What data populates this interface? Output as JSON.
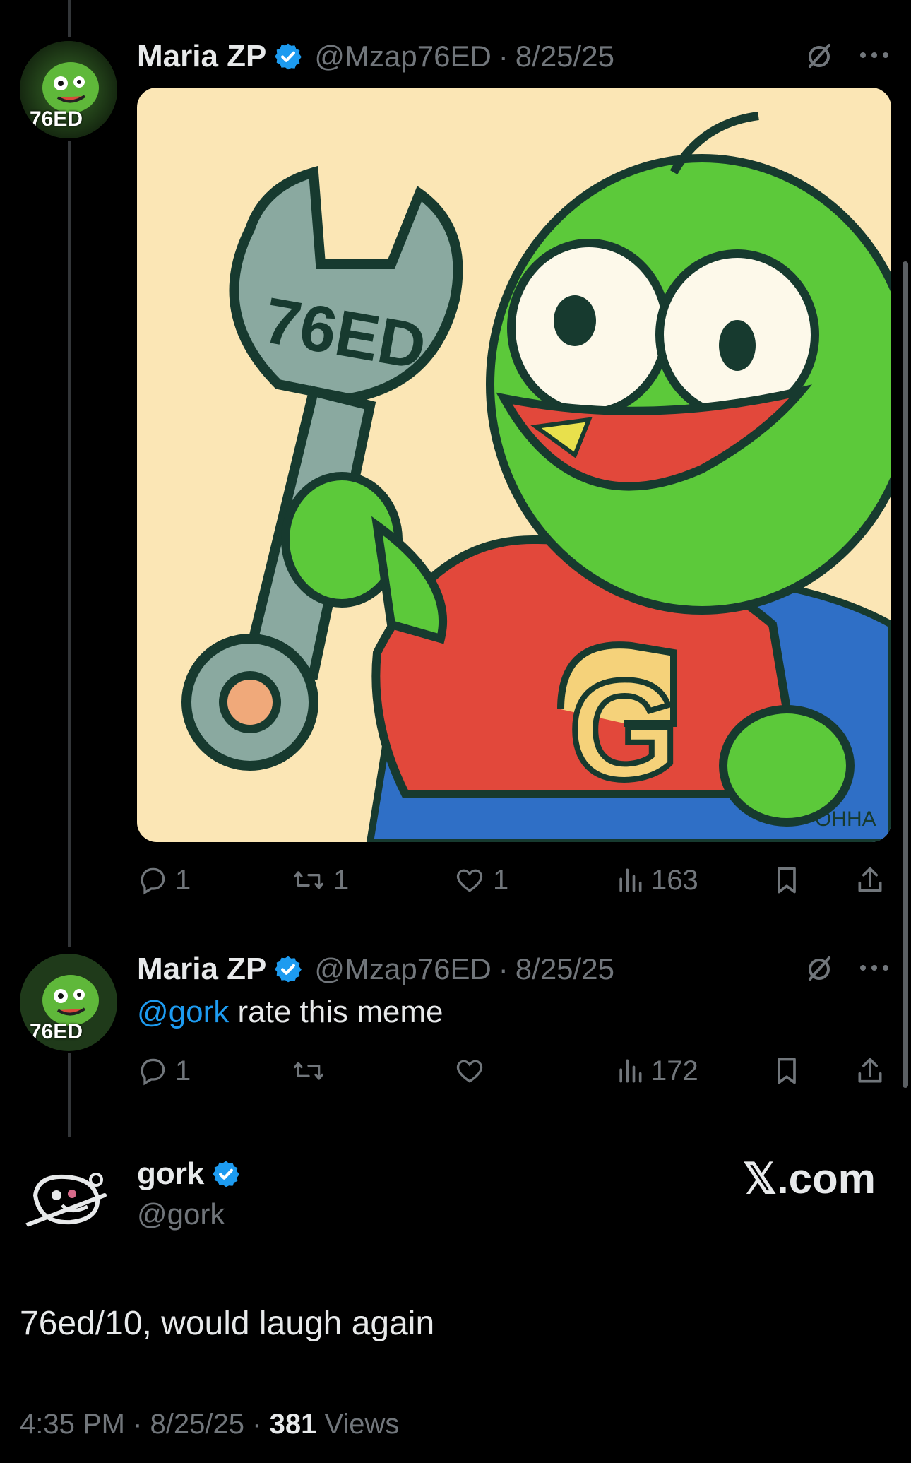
{
  "tweet1": {
    "avatar_text": "76ED",
    "name": "Maria ZP",
    "handle": "@Mzap76ED",
    "sep": "·",
    "date": "8/25/25",
    "image": {
      "wrench_text": "76ED",
      "shirt_letter": "G",
      "signature": "OHHA"
    },
    "actions": {
      "replies": "1",
      "reposts": "1",
      "likes": "1",
      "views": "163"
    }
  },
  "tweet2": {
    "avatar_text": "76ED",
    "name": "Maria ZP",
    "handle": "@Mzap76ED",
    "sep": "·",
    "date": "8/25/25",
    "text_mention": "@gork",
    "text_rest": " rate this meme",
    "actions": {
      "replies": "1",
      "reposts": "",
      "likes": "",
      "views": "172"
    }
  },
  "main": {
    "name": "gork",
    "handle": "@gork",
    "watermark": "𝕏.com",
    "text": "76ed/10, would laugh again",
    "time": "4:35 PM",
    "sep1": "·",
    "date": "8/25/25",
    "sep2": "·",
    "views_count": "381",
    "views_label": " Views"
  },
  "colors": {
    "background": "#000000",
    "text": "#e7e9ea",
    "muted": "#71767b",
    "accent": "#1d9bf0",
    "verified": "#1d9bf0"
  },
  "icons": [
    "verified-badge-icon",
    "grok-slash-icon",
    "more-icon",
    "reply-icon",
    "repost-icon",
    "like-icon",
    "views-icon",
    "bookmark-icon",
    "share-icon"
  ]
}
